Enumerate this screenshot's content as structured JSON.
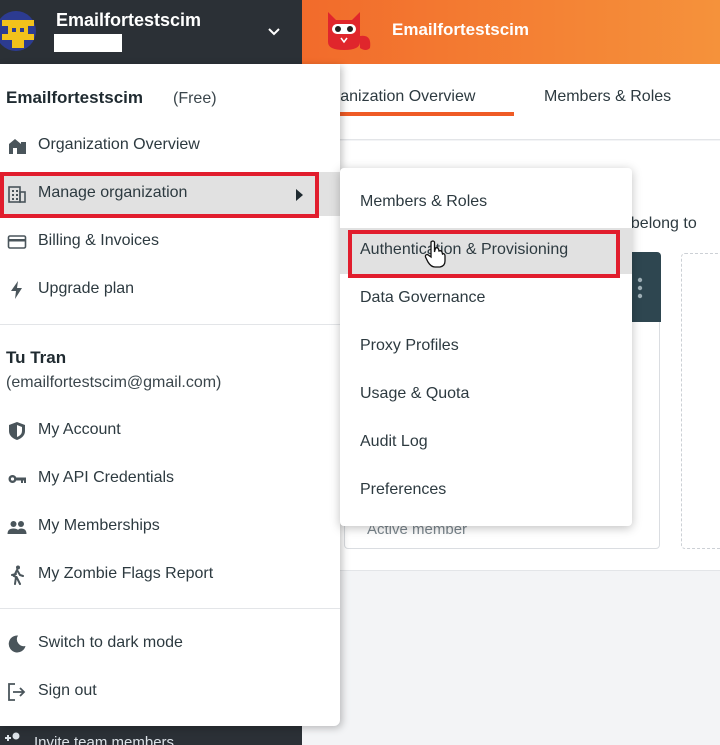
{
  "sidebar": {
    "org_name": "Emailfortestscim",
    "invite_label": "Invite team members"
  },
  "header": {
    "title": "Emailfortestscim"
  },
  "main": {
    "tabs": [
      {
        "label": "rganization Overview"
      },
      {
        "label": "Members & Roles"
      }
    ],
    "belong_text": ": belong to",
    "card_status": "Active member"
  },
  "dropdown": {
    "org_name": "Emailfortestscim",
    "plan": "(Free)",
    "org_items": [
      {
        "label": "Organization Overview",
        "icon": "building-icon"
      },
      {
        "label": "Manage organization",
        "icon": "office-building-icon"
      },
      {
        "label": "Billing & Invoices",
        "icon": "credit-card-icon"
      },
      {
        "label": "Upgrade plan",
        "icon": "lightning-icon"
      }
    ],
    "user_name": "Tu Tran",
    "user_email": "(emailfortestscim@gmail.com)",
    "user_items": [
      {
        "label": "My Account",
        "icon": "shield-icon"
      },
      {
        "label": "My API Credentials",
        "icon": "key-icon"
      },
      {
        "label": "My Memberships",
        "icon": "people-icon"
      },
      {
        "label": "My Zombie Flags Report",
        "icon": "walking-person-icon"
      }
    ],
    "footer_items": [
      {
        "label": "Switch to dark mode",
        "icon": "moon-icon"
      },
      {
        "label": "Sign out",
        "icon": "sign-out-icon"
      }
    ]
  },
  "submenu": {
    "items": [
      {
        "label": "Members & Roles"
      },
      {
        "label": "Authentication & Provisioning"
      },
      {
        "label": "Data Governance"
      },
      {
        "label": "Proxy Profiles"
      },
      {
        "label": "Usage & Quota"
      },
      {
        "label": "Audit Log"
      },
      {
        "label": "Preferences"
      }
    ]
  },
  "colors": {
    "sidebar_bg": "#2b3036",
    "header_orange": "#f26b2b",
    "highlight_red": "#e11d2d",
    "tab_underline": "#ef5b25"
  }
}
